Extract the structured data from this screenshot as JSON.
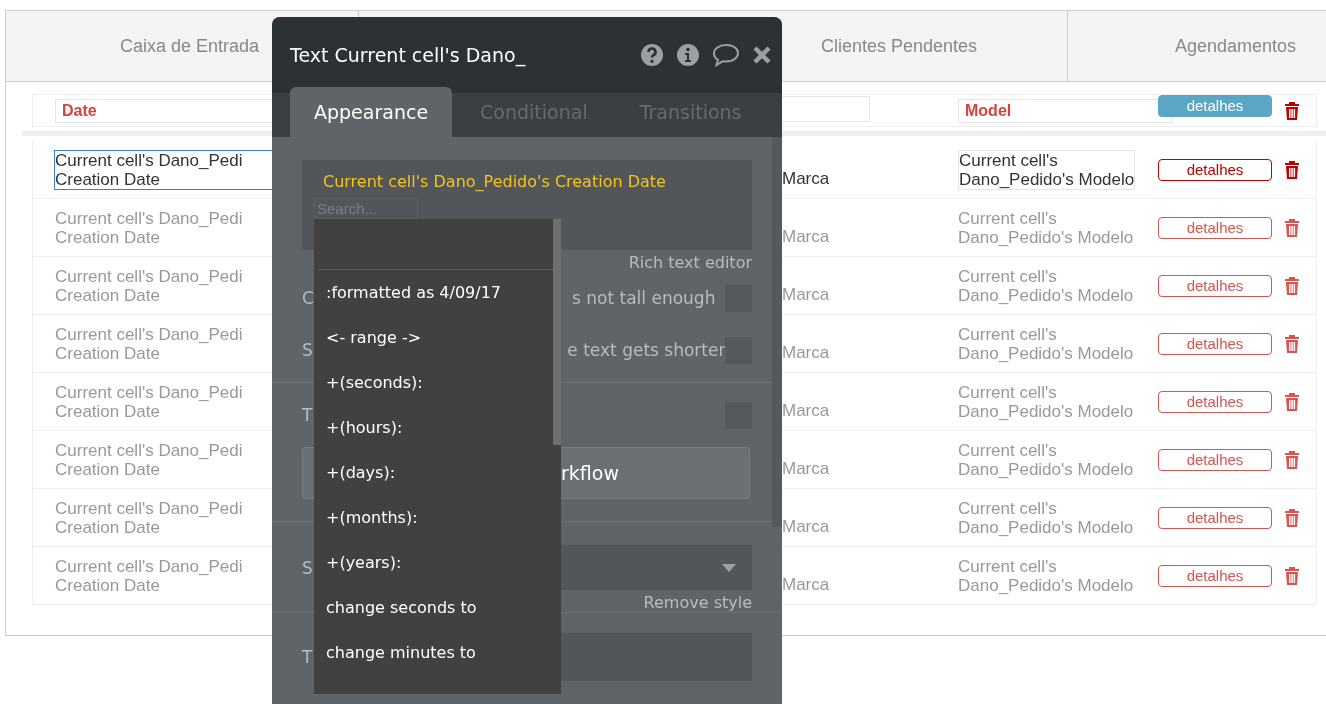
{
  "tabs": [
    {
      "label": "Caixa de Entrada"
    },
    {
      "label": "Clientes Pendentes"
    },
    {
      "label": "Agendamentos"
    }
  ],
  "list_header": {
    "date": "Date",
    "model": "Model",
    "button": "detalhes"
  },
  "rows": [
    {
      "selected": true,
      "date_lines": [
        "Current cell's Dano_Pedi",
        "Creation Date"
      ],
      "brand": "Marca",
      "model_lines": [
        "Current cell's",
        "Dano_Pedido's Modelo"
      ],
      "button": "detalhes"
    },
    {
      "selected": false,
      "date_lines": [
        "Current cell's Dano_Pedi",
        "Creation Date"
      ],
      "brand": "Marca",
      "model_lines": [
        "Current cell's",
        "Dano_Pedido's Modelo"
      ],
      "button": "detalhes"
    },
    {
      "selected": false,
      "date_lines": [
        "Current cell's Dano_Pedi",
        "Creation Date"
      ],
      "brand": "Marca",
      "model_lines": [
        "Current cell's",
        "Dano_Pedido's Modelo"
      ],
      "button": "detalhes"
    },
    {
      "selected": false,
      "date_lines": [
        "Current cell's Dano_Pedi",
        "Creation Date"
      ],
      "brand": "Marca",
      "model_lines": [
        "Current cell's",
        "Dano_Pedido's Modelo"
      ],
      "button": "detalhes"
    },
    {
      "selected": false,
      "date_lines": [
        "Current cell's Dano_Pedi",
        "Creation Date"
      ],
      "brand": "Marca",
      "model_lines": [
        "Current cell's",
        "Dano_Pedido's Modelo"
      ],
      "button": "detalhes"
    },
    {
      "selected": false,
      "date_lines": [
        "Current cell's Dano_Pedi",
        "Creation Date"
      ],
      "brand": "Marca",
      "model_lines": [
        "Current cell's",
        "Dano_Pedido's Modelo"
      ],
      "button": "detalhes"
    },
    {
      "selected": false,
      "date_lines": [
        "Current cell's Dano_Pedi",
        "Creation Date"
      ],
      "brand": "Marca",
      "model_lines": [
        "Current cell's",
        "Dano_Pedido's Modelo"
      ],
      "button": "detalhes"
    },
    {
      "selected": false,
      "date_lines": [
        "Current cell's Dano_Pedi",
        "Creation Date"
      ],
      "brand": "Marca",
      "model_lines": [
        "Current cell's",
        "Dano_Pedido's Modelo"
      ],
      "button": "detalhes"
    }
  ],
  "panel": {
    "title": "Text Current cell's Dano_",
    "tabs": [
      {
        "label": "Appearance",
        "selected": true
      },
      {
        "label": "Conditional",
        "selected": false
      },
      {
        "label": "Transitions",
        "selected": false
      }
    ],
    "expression": "Current cell's Dano_Pedido's Creation Date",
    "search_placeholder": "Search...",
    "rich_text_link": "Rich text editor",
    "check_rows": [
      {
        "left": "C",
        "right": "s not tall enough",
        "checked": false
      },
      {
        "left": "S",
        "right": "e text gets shorter",
        "checked": false
      },
      {
        "left": "T",
        "right": "",
        "checked": false
      }
    ],
    "workflow_button": "rkflow",
    "style_label": "S",
    "remove_style": "Remove style",
    "bottom_label": "T",
    "dropdown_items": [
      ":formatted as 4/09/17",
      "<- range ->",
      "+(seconds):",
      "+(hours):",
      "+(days):",
      "+(months):",
      "+(years):",
      "change seconds to",
      "change minutes to"
    ]
  }
}
